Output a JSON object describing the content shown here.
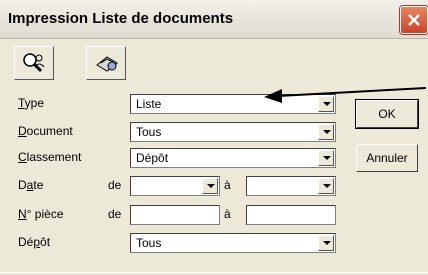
{
  "window": {
    "title": "Impression Liste de documents"
  },
  "toolbar": {
    "search_icon": "search-people-icon",
    "printer_icon": "printer-preview-icon"
  },
  "form": {
    "type": {
      "label_u": "T",
      "label_rest": "ype",
      "value": "Liste"
    },
    "document": {
      "label_u": "D",
      "label_rest": "ocument",
      "value": "Tous"
    },
    "classement": {
      "label_u": "C",
      "label_rest": "lassement",
      "value": "Dépôt"
    },
    "date": {
      "label_pre": "D",
      "label_u": "a",
      "label_rest": "te",
      "de": "de",
      "a": "à"
    },
    "piece": {
      "label_u": "N",
      "label_rest": "° pièce",
      "de": "de",
      "a": "à"
    },
    "depot": {
      "label_pre": "Dé",
      "label_u": "p",
      "label_rest": "ôt",
      "value": "Tous"
    }
  },
  "buttons": {
    "ok": "OK",
    "cancel": "Annuler"
  }
}
